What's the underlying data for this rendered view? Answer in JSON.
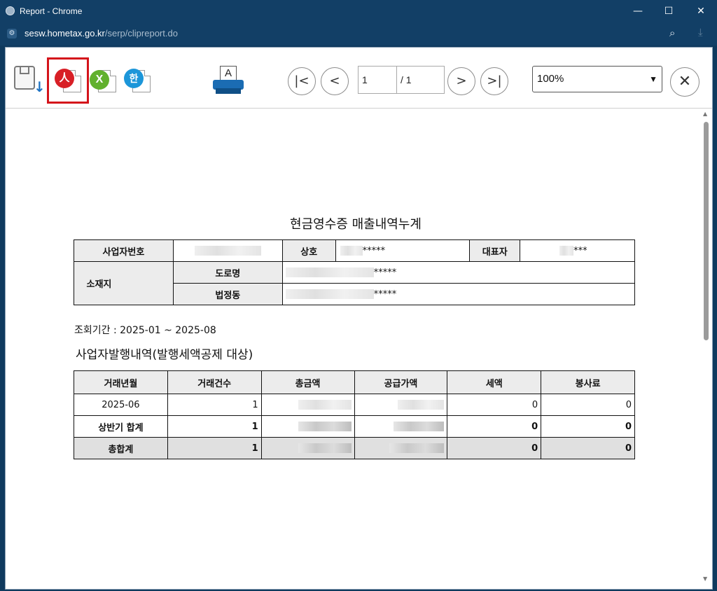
{
  "window": {
    "title": "Report - Chrome"
  },
  "address": {
    "host": "sesw.hometax.go.kr",
    "path": "/serp/clipreport.do"
  },
  "toolbar": {
    "page_current": "1",
    "page_total": "/ 1",
    "zoom": "100%",
    "icons": [
      "save-icon",
      "pdf-icon",
      "excel-icon",
      "hwp-icon",
      "print-icon"
    ]
  },
  "report": {
    "title": "현금영수증 매출내역누계",
    "info": {
      "biz_no_label": "사업자번호",
      "company_label": "상호",
      "company_value": "*****",
      "ceo_label": "대표자",
      "ceo_value": "***",
      "address_label": "소재지",
      "road_label": "도로명",
      "road_value": "*****",
      "lot_label": "법정동",
      "lot_value": "*****"
    },
    "period_label": "조회기간 :",
    "period_value": "2025-01 ~ 2025-08",
    "section_title": "사업자발행내역(발행세액공제 대상)",
    "table": {
      "headers": [
        "거래년월",
        "거래건수",
        "총금액",
        "공급가액",
        "세액",
        "봉사료"
      ],
      "rows": [
        {
          "month": "2025-06",
          "count": "1",
          "tax": "0",
          "service": "0"
        },
        {
          "month": "상반기 합계",
          "count": "1",
          "tax": "0",
          "service": "0"
        },
        {
          "month": "총합계",
          "count": "1",
          "tax": "0",
          "service": "0"
        }
      ]
    }
  }
}
